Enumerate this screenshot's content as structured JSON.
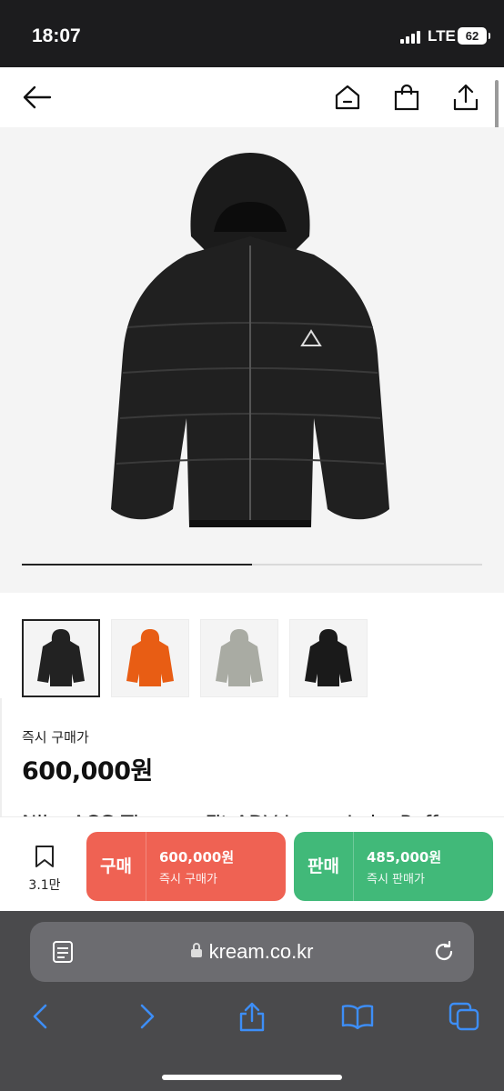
{
  "status_bar": {
    "time": "18:07",
    "network": "LTE",
    "battery": "62"
  },
  "app_header": {
    "back_icon": "arrow-left-icon",
    "home_icon": "home-icon",
    "bag_icon": "shopping-bag-icon",
    "share_icon": "share-icon"
  },
  "gallery": {
    "progress": 0.5,
    "thumbnails": [
      "black",
      "orange",
      "grey",
      "black"
    ],
    "selected_index": 0
  },
  "product": {
    "instant_buy_label": "즉시 구매가",
    "price": "600,000원",
    "name": "Nike ACG Therma-Fit ADV Lunar Lake Puffer"
  },
  "actions": {
    "wish_count": "3.1만",
    "buy": {
      "label": "구매",
      "price": "600,000원",
      "sub": "즉시 구매가"
    },
    "sell": {
      "label": "판매",
      "price": "485,000원",
      "sub": "즉시 판매가"
    },
    "colors": {
      "buy": "#ef6253",
      "sell": "#41b979"
    }
  },
  "browser": {
    "url": "kream.co.kr"
  }
}
